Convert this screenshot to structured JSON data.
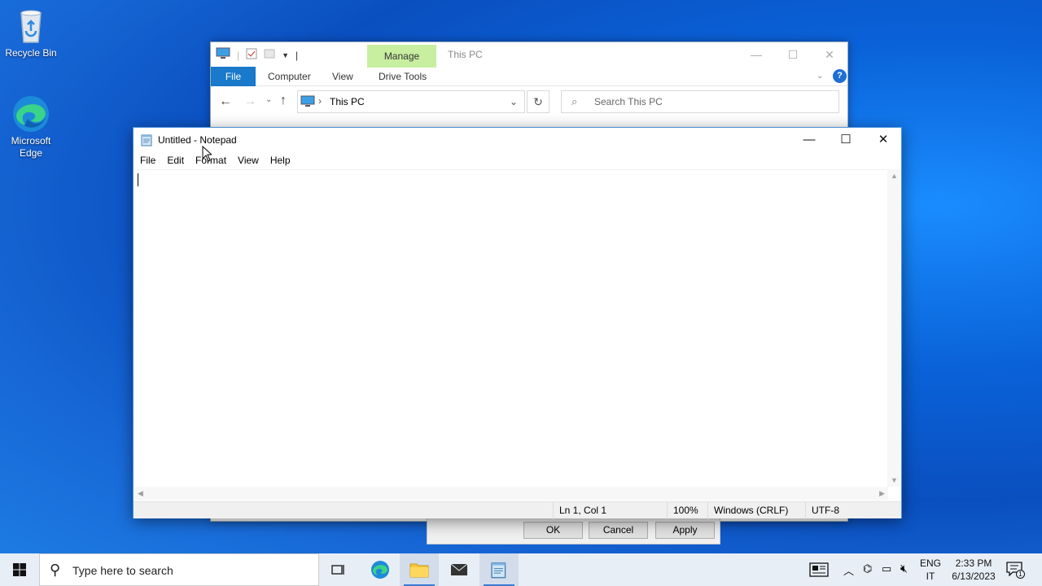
{
  "desktop": {
    "icons": [
      {
        "label": "Recycle Bin"
      },
      {
        "label": "Microsoft Edge"
      }
    ]
  },
  "explorer": {
    "title": "This PC",
    "manage_tab": "Manage",
    "ribbon_tabs": {
      "file": "File",
      "computer": "Computer",
      "view": "View",
      "drive_tools": "Drive Tools"
    },
    "address": "This PC",
    "search_placeholder": "Search This PC"
  },
  "dialog": {
    "ok": "OK",
    "cancel": "Cancel",
    "apply": "Apply"
  },
  "notepad": {
    "title": "Untitled - Notepad",
    "menu": {
      "file": "File",
      "edit": "Edit",
      "format": "Format",
      "view": "View",
      "help": "Help"
    },
    "content": "",
    "status": {
      "position": "Ln 1, Col 1",
      "zoom": "100%",
      "line_endings": "Windows (CRLF)",
      "encoding": "UTF-8"
    }
  },
  "taskbar": {
    "search_placeholder": "Type here to search",
    "language_top": "ENG",
    "language_bottom": "IT",
    "time": "2:33 PM",
    "date": "6/13/2023",
    "notification_count": "1"
  },
  "colors": {
    "accent": "#1979ca",
    "manage_tab": "#c8eea0",
    "desktop": "#0a62d8"
  }
}
